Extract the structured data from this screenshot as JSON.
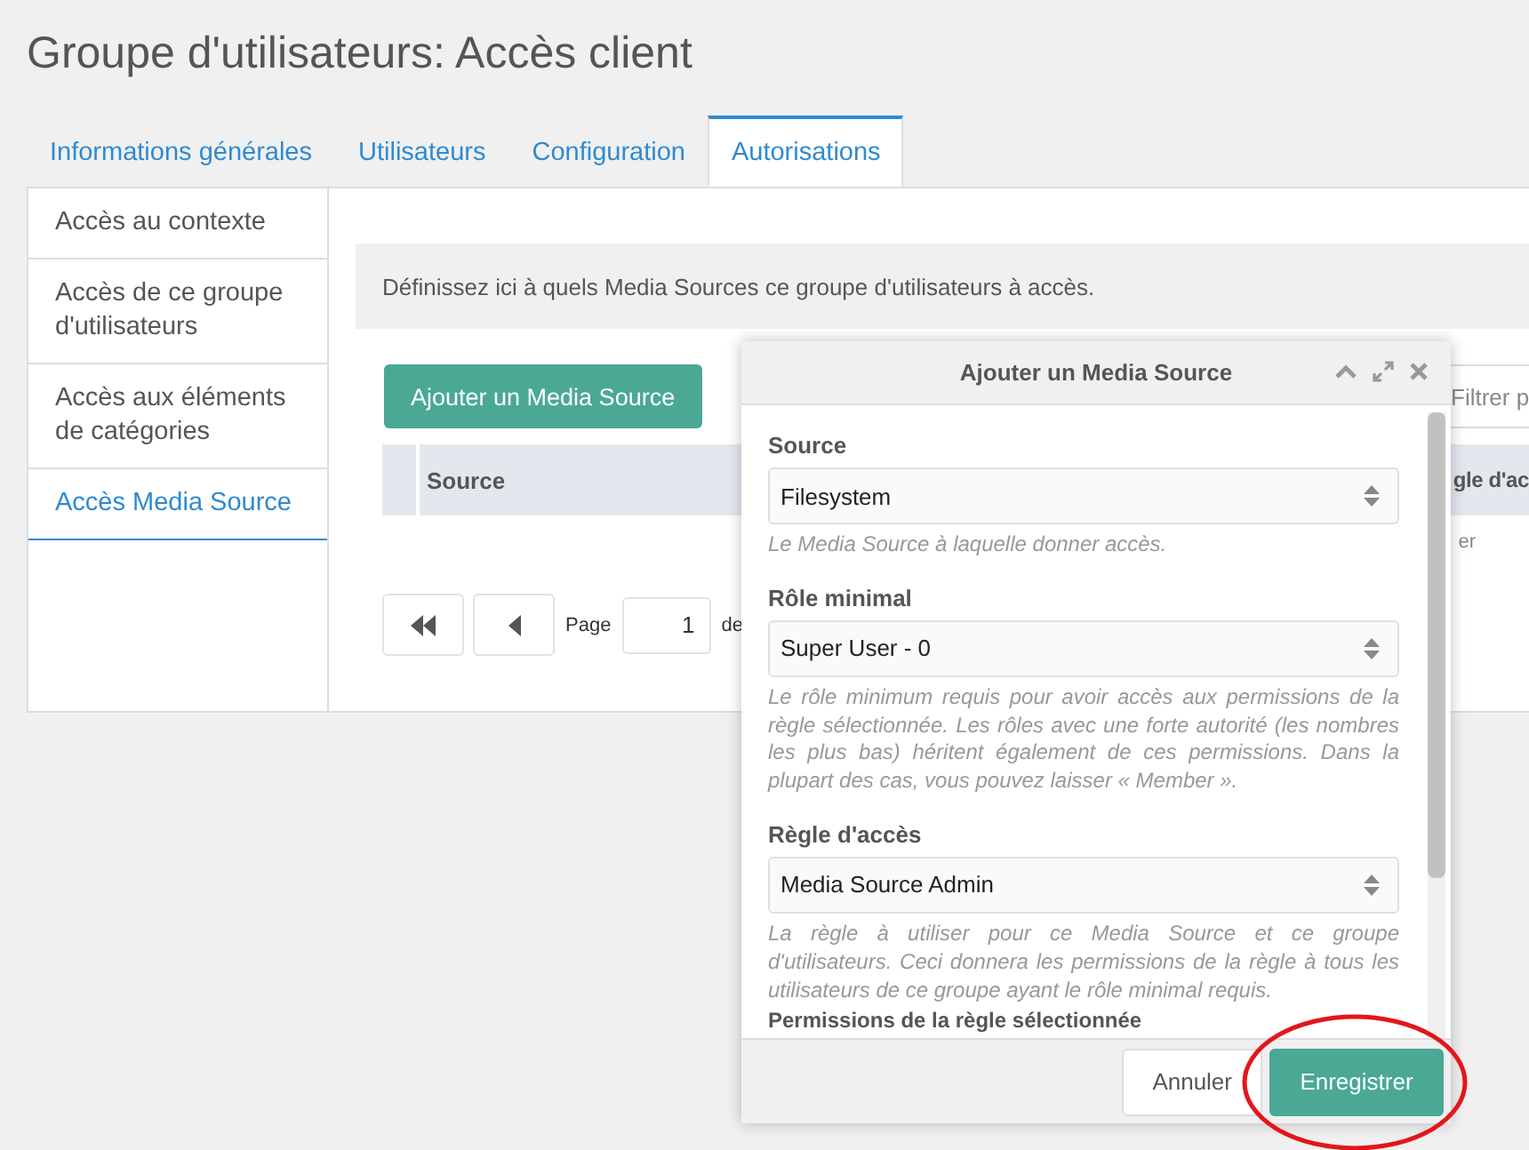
{
  "page_title": "Groupe d'utilisateurs: Accès client",
  "tabs": [
    {
      "label": "Informations générales",
      "selected": false
    },
    {
      "label": "Utilisateurs",
      "selected": false
    },
    {
      "label": "Configuration",
      "selected": false
    },
    {
      "label": "Autorisations",
      "selected": true
    }
  ],
  "sidebar": {
    "items": [
      {
        "label": "Accès au contexte",
        "selected": false
      },
      {
        "label": "Accès de ce groupe d'utilisateurs",
        "selected": false
      },
      {
        "label": "Accès aux éléments de catégories",
        "selected": false
      },
      {
        "label": "Accès Media Source",
        "selected": true
      }
    ]
  },
  "description": "Définissez ici à quels Media Sources ce groupe d'utilisateurs à accès.",
  "add_button": "Ajouter un Media Source",
  "filter": {
    "placeholder": "Filtrer p"
  },
  "table": {
    "columns": [
      "Source",
      "gle d'ac"
    ],
    "row_text": "er"
  },
  "pagination": {
    "label": "Page",
    "value": "1",
    "suffix": "de"
  },
  "modal": {
    "title": "Ajouter un Media Source",
    "fields": [
      {
        "label": "Source",
        "value": "Filesystem",
        "help": "Le Media Source à laquelle donner accès."
      },
      {
        "label": "Rôle minimal",
        "value": "Super User - 0",
        "help": "Le rôle minimum requis pour avoir accès aux permissions de la règle sélectionnée. Les rôles avec une forte autorité (les nombres les plus bas) héritent également de ces permissions. Dans la plupart des cas, vous pouvez laisser « Member »."
      },
      {
        "label": "Règle d'accès",
        "value": "Media Source Admin",
        "help": "La règle à utiliser pour ce Media Source et ce groupe d'utilisateurs. Ceci donnera les permissions de la règle à tous les utilisateurs de ce groupe ayant le rôle minimal requis."
      }
    ],
    "section_heading": "Permissions de la règle sélectionnée",
    "cancel_button": "Annuler",
    "save_button": {
      "label": "Enregistrer",
      "highlighted": true
    }
  }
}
